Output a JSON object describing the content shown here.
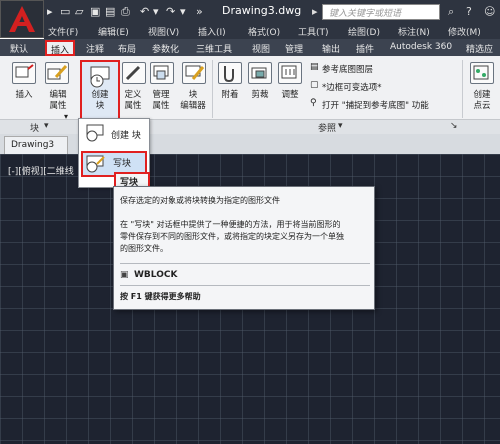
{
  "window": {
    "title": "Drawing3.dwg",
    "search_placeholder": "键入关键字或短语"
  },
  "quick_access": {
    "more_icon": "»",
    "undo_icon": "↶",
    "redo_icon": "↷"
  },
  "menubar": {
    "items": [
      "文件(F)",
      "编辑(E)",
      "视图(V)",
      "插入(I)",
      "格式(O)",
      "工具(T)",
      "绘图(D)",
      "标注(N)",
      "修改(M)"
    ]
  },
  "ribbon_tabs": {
    "items": [
      "默认",
      "插入",
      "注释",
      "布局",
      "参数化",
      "三维工具",
      "视图",
      "管理",
      "输出",
      "插件",
      "Autodesk 360",
      "精选应"
    ],
    "active": "插入"
  },
  "ribbon": {
    "insert_label": "插入",
    "edit_attr_label": "编辑\n属性",
    "create_block_label": "创建\n块",
    "define_attr_label": "定义\n属性",
    "manage_attr_label": "管理\n属性",
    "block_editor_label": "块\n编辑器",
    "attach_label": "附着",
    "clip_label": "剪裁",
    "adjust_label": "调整",
    "underlay_layers_label": "参考底图图层",
    "frame_var_label": "*边框可变选项*",
    "open_snap_label": "打开 \"捕捉到参考底图\" 功能",
    "create_point_cloud_label": "创建\n点云",
    "block_panel_title": "块",
    "reference_panel_title": "参照",
    "dropdown_arrow": "▾"
  },
  "dropdown": {
    "items": [
      "创建 块",
      "写块"
    ]
  },
  "document": {
    "tab_label": "Drawing3",
    "view_label": "[-][俯视][二维线"
  },
  "tooltip": {
    "title": "写块",
    "summary": "保存选定的对象或将块转换为指定的图形文件",
    "detail_line1": "在 \"写块\" 对话框中提供了一种便捷的方法，用于将当前图形的",
    "detail_line2": "零件保存到不同的图形文件，或将指定的块定义另存为一个单独",
    "detail_line3": "的图形文件。",
    "command": "WBLOCK",
    "help": "按 F1 键获得更多帮助"
  },
  "colors": {
    "accent_red": "#e02020",
    "titlebar": "#2e3440",
    "canvas": "#1e2330"
  }
}
